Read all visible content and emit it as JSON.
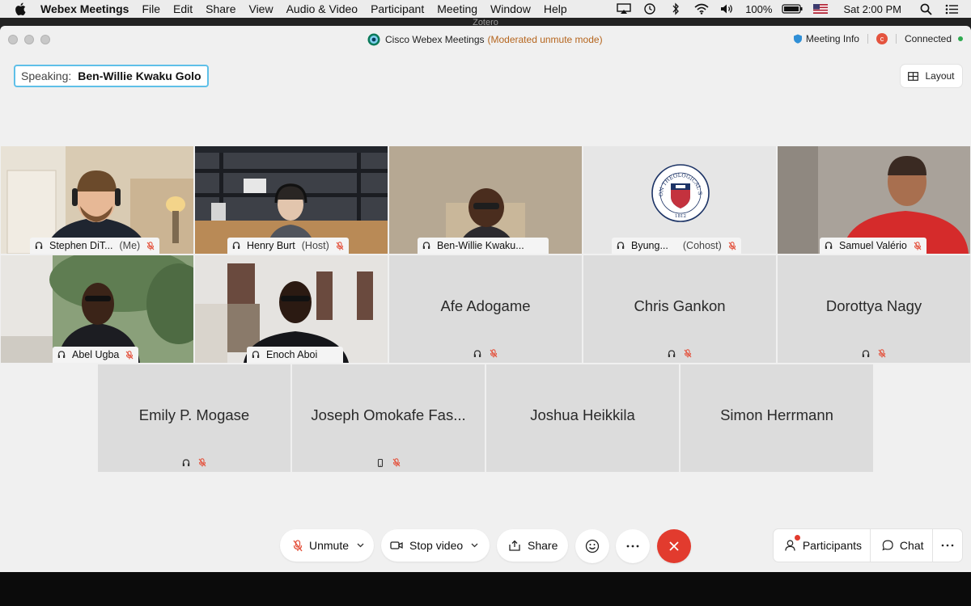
{
  "menubar": {
    "app": "Webex Meetings",
    "items": [
      "File",
      "Edit",
      "Share",
      "View",
      "Audio & Video",
      "Participant",
      "Meeting",
      "Window",
      "Help"
    ],
    "battery": "100%",
    "clock": "Sat 2:00 PM"
  },
  "behind_window_title": "Zotero",
  "window": {
    "title": "Cisco Webex Meetings",
    "mode": "(Moderated unmute mode)",
    "meeting_info": "Meeting Info",
    "rec_badge": "c",
    "status": "Connected"
  },
  "speaking": {
    "label": "Speaking:",
    "name": "Ben-Willie Kwaku Golo"
  },
  "layout_label": "Layout",
  "video_tiles": [
    {
      "name": "Stephen DiT...",
      "role": "(Me)"
    },
    {
      "name": "Henry Burt",
      "role": "(Host)"
    },
    {
      "name": "Ben-Willie Kwaku...",
      "role": ""
    },
    {
      "name": "Byung...",
      "role": "(Cohost)"
    },
    {
      "name": "Samuel Valério",
      "role": ""
    },
    {
      "name": "Abel Ugba",
      "role": ""
    },
    {
      "name": "Enoch Aboi",
      "role": ""
    }
  ],
  "seal_text": "PRINCETON THEOLOGICAL SEMINARY",
  "seal_year": "1812",
  "name_tiles": [
    {
      "name": "Afe Adogame",
      "device": "headset"
    },
    {
      "name": "Chris Gankon",
      "device": "headset"
    },
    {
      "name": "Dorottya Nagy",
      "device": "headset"
    },
    {
      "name": "Emily P. Mogase",
      "device": "headset"
    },
    {
      "name": "Joseph Omokafe Fas...",
      "device": "phone"
    },
    {
      "name": "Joshua Heikkila",
      "device": "none"
    },
    {
      "name": "Simon Herrmann",
      "device": "none"
    }
  ],
  "controls": {
    "unmute": "Unmute",
    "stop_video": "Stop video",
    "share": "Share",
    "participants": "Participants",
    "chat": "Chat"
  },
  "colors": {
    "accent": "#31b7e8",
    "leave": "#e23b2e",
    "muted_mic": "#e4533e",
    "mode_text": "#b5651d",
    "connected": "#2eaa4f"
  }
}
